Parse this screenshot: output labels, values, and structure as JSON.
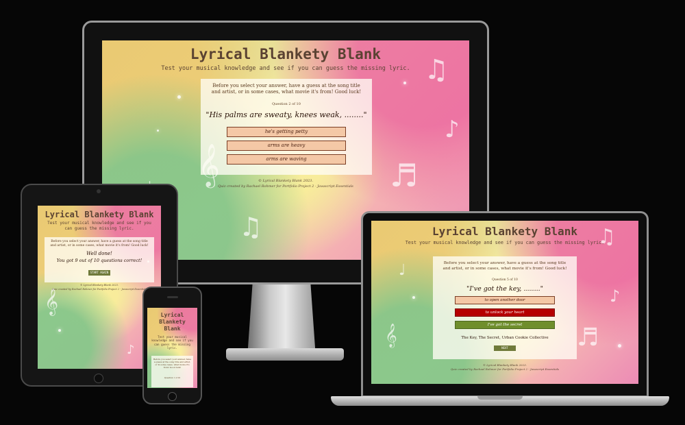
{
  "app": {
    "title": "Lyrical Blankety Blank",
    "subtitle": "Test your musical knowledge and see if you can guess the missing lyric.",
    "footer_copyright": "© Lyrical Blankety Blank 2023.",
    "footer_credit": "Quiz created by Rachael Rohmer for Portfolio Project 2 - Javascript Essentials"
  },
  "desktop": {
    "intro": "Before you select your answer, have a guess at the song title and artist, or in some cases, what movie it's from! Good luck!",
    "question_counter": "Question 2 of 10",
    "lyric": "\"His palms are sweaty, knees weak, ........\"",
    "answers": [
      "he's getting petty",
      "arms are heavy",
      "arms are waving"
    ]
  },
  "tablet": {
    "intro": "Before you select your answer, have a guess at the song title and artist, or in some cases, what movie it's from! Good luck!",
    "result_line1": "Well done!",
    "result_line2": "You got 9 out of 10 questions correct!",
    "restart_label": "START AGAIN"
  },
  "phone": {
    "intro": "Before you select your answer, have a guess at the song title and artist, or in some cases, what movie it's from! Good luck!",
    "question_counter": "Question 1 of 10"
  },
  "laptop": {
    "intro": "Before you select your answer, have a guess at the song title and artist, or in some cases, what movie it's from! Good luck!",
    "question_counter": "Question 5 of 10",
    "lyric": "\"I've got the key, ........\"",
    "answers": [
      "to open another door",
      "to unlock your heart",
      "I've got the secret"
    ],
    "song_reveal": "The Key, The Secret, Urban Cookie Collective",
    "next_label": "NEXT"
  },
  "colors": {
    "background": "#060606",
    "title_text": "#5a4232",
    "answer_default": "#f4c8a6",
    "answer_wrong": "#b60000",
    "answer_correct": "#6f8e2c",
    "button": "#6f7a3a"
  }
}
